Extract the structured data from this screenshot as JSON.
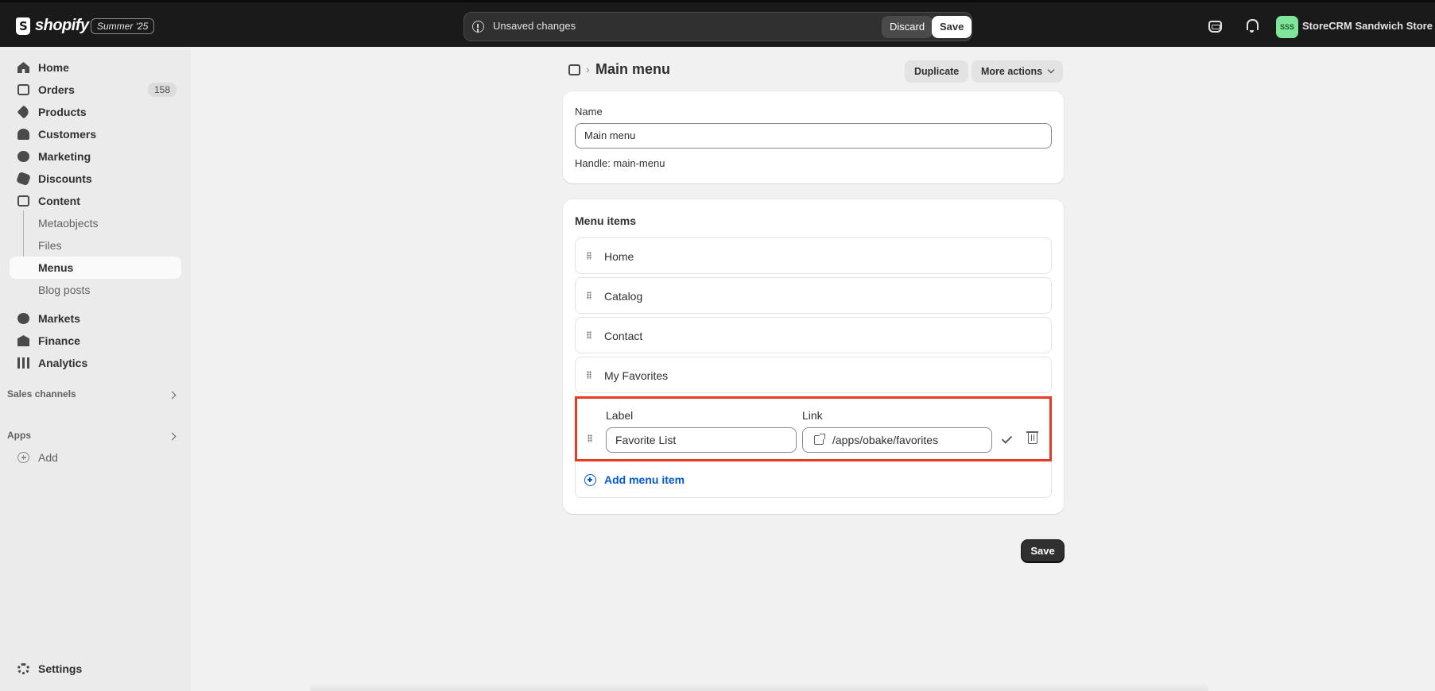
{
  "topbar": {
    "brand": "shopify",
    "edition": "Summer '25",
    "unsaved_text": "Unsaved changes",
    "discard_label": "Discard",
    "save_label": "Save",
    "avatar_initials": "SSS",
    "store_name": "StoreCRM Sandwich Store"
  },
  "sidebar": {
    "items": [
      {
        "label": "Home",
        "icon": "home-icon"
      },
      {
        "label": "Orders",
        "icon": "orders-icon",
        "badge": "158"
      },
      {
        "label": "Products",
        "icon": "tag-icon"
      },
      {
        "label": "Customers",
        "icon": "person-icon"
      },
      {
        "label": "Marketing",
        "icon": "target-icon"
      },
      {
        "label": "Discounts",
        "icon": "discount-icon"
      },
      {
        "label": "Content",
        "icon": "content-icon"
      }
    ],
    "content_sub": [
      {
        "label": "Metaobjects"
      },
      {
        "label": "Files"
      },
      {
        "label": "Menus"
      },
      {
        "label": "Blog posts"
      }
    ],
    "items2": [
      {
        "label": "Markets",
        "icon": "globe-icon"
      },
      {
        "label": "Finance",
        "icon": "bank-icon"
      },
      {
        "label": "Analytics",
        "icon": "chart-icon"
      }
    ],
    "sales_channels": "Sales channels",
    "apps": "Apps",
    "add": "Add",
    "settings": "Settings"
  },
  "page": {
    "title": "Main menu",
    "duplicate_label": "Duplicate",
    "more_actions_label": "More actions",
    "name_label": "Name",
    "name_value": "Main menu",
    "handle_text": "Handle: main-menu",
    "menu_items_title": "Menu items",
    "menu_items": [
      {
        "label": "Home"
      },
      {
        "label": "Catalog"
      },
      {
        "label": "Contact"
      },
      {
        "label": "My Favorites"
      }
    ],
    "edit": {
      "label_heading": "Label",
      "label_value": "Favorite List",
      "link_heading": "Link",
      "link_value": "/apps/obake/favorites"
    },
    "add_menu_item": "Add menu item",
    "save_label": "Save"
  },
  "colors": {
    "highlight": "#e63a23",
    "link": "#005bd3",
    "topbar": "#1a1a1a"
  }
}
